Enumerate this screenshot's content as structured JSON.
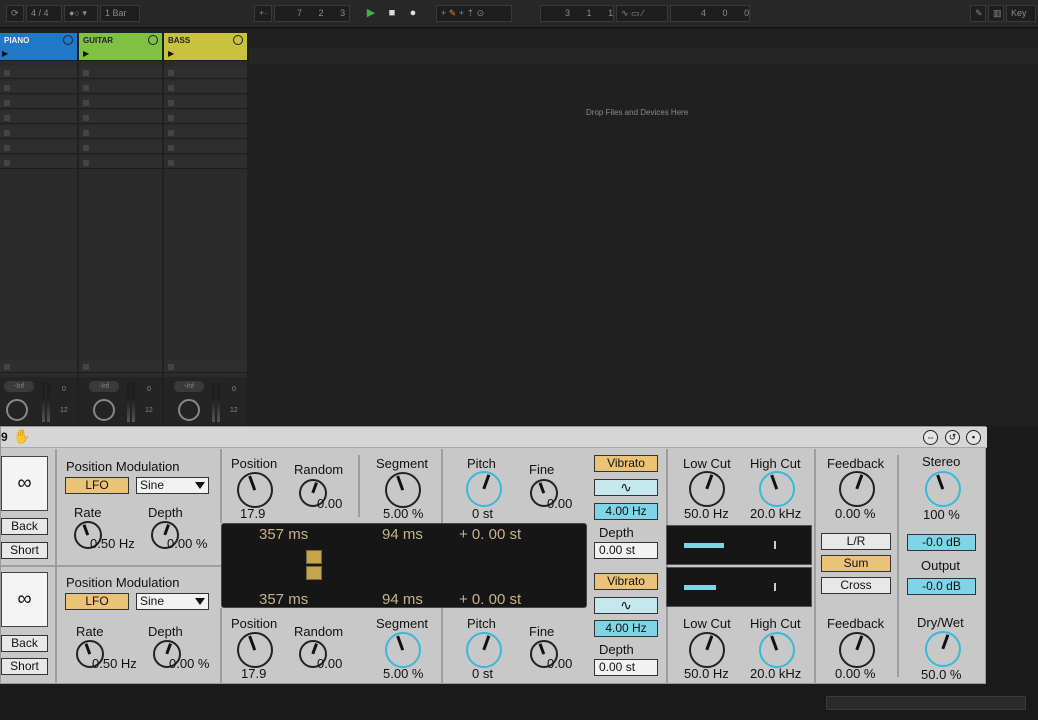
{
  "topbar": {
    "time_sig": "4 / 4",
    "quantize": "1 Bar",
    "arrangement_pos": [
      "7",
      "2",
      "3"
    ],
    "loop_start": [
      "3",
      "1",
      "1"
    ],
    "loop_length": [
      "4",
      "0",
      "0"
    ],
    "key_label": "Key"
  },
  "tracks": [
    {
      "name": "PIANO",
      "color": "#1f78c8"
    },
    {
      "name": "GUITAR",
      "color": "#7fc242"
    },
    {
      "name": "BASS",
      "color": "#c9c23c"
    }
  ],
  "mixer": {
    "volume": "-Inf",
    "meter_top": "0",
    "meter_mid": "12"
  },
  "drop_text": "Drop Files and Devices Here",
  "device": {
    "title": "9",
    "lane1": {
      "loop_icon": "∞",
      "back_label": "Back",
      "short_label": "Short",
      "pos_mod_title": "Position Modulation",
      "lfo_label": "LFO",
      "wave_select": "Sine",
      "rate_label": "Rate",
      "rate_value": "0.50 Hz",
      "depth_label": "Depth",
      "depth_value": "0.00 %",
      "position_label": "Position",
      "position_value": "17.9",
      "random_label": "Random",
      "random_value": "0.00",
      "segment_label": "Segment",
      "segment_value": "5.00 %",
      "pitch_label": "Pitch",
      "pitch_value": "0 st",
      "fine_label": "Fine",
      "fine_value": "0.00",
      "vibrato_label": "Vibrato",
      "vib_rate": "4.00 Hz",
      "vib_depth_label": "Depth",
      "vib_depth_value": "0.00 st",
      "lowcut_label": "Low Cut",
      "lowcut_value": "50.0 Hz",
      "highcut_label": "High Cut",
      "highcut_value": "20.0 kHz",
      "feedback_label": "Feedback",
      "feedback_value": "0.00 %"
    },
    "lane2": {
      "loop_icon": "∞",
      "back_label": "Back",
      "short_label": "Short",
      "pos_mod_title": "Position Modulation",
      "lfo_label": "LFO",
      "wave_select": "Sine",
      "rate_label": "Rate",
      "rate_value": "0.50 Hz",
      "depth_label": "Depth",
      "depth_value": "0.00 %",
      "position_label": "Position",
      "position_value": "17.9",
      "random_label": "Random",
      "random_value": "0.00",
      "segment_label": "Segment",
      "segment_value": "5.00 %",
      "pitch_label": "Pitch",
      "pitch_value": "0 st",
      "fine_label": "Fine",
      "fine_value": "0.00",
      "vibrato_label": "Vibrato",
      "vib_rate": "4.00 Hz",
      "vib_depth_label": "Depth",
      "vib_depth_value": "0.00 st",
      "lowcut_label": "Low Cut",
      "lowcut_value": "50.0 Hz",
      "highcut_label": "High Cut",
      "highcut_value": "20.0 kHz",
      "feedback_label": "Feedback",
      "feedback_value": "0.00 %"
    },
    "display": {
      "top_time": "357 ms",
      "top_segment": "94 ms",
      "top_pitch": "+  0. 00 st",
      "bottom_time": "357 ms",
      "bottom_segment": "94 ms",
      "bottom_pitch": "+  0. 00 st"
    },
    "routing": {
      "lr_label": "L/R",
      "sum_label": "Sum",
      "cross_label": "Cross"
    },
    "output_section": {
      "stereo_label": "Stereo",
      "stereo_value": "100 %",
      "gain1_value": "-0.0 dB",
      "output_label": "Output",
      "output_value": "-0.0 dB",
      "drywet_label": "Dry/Wet",
      "drywet_value": "50.0 %"
    }
  },
  "colors": {
    "accent_yellow": "#eac379",
    "accent_blue": "#7fd5e5",
    "knob_blue": "#3ab8d8",
    "display_text": "#c8b48a"
  }
}
